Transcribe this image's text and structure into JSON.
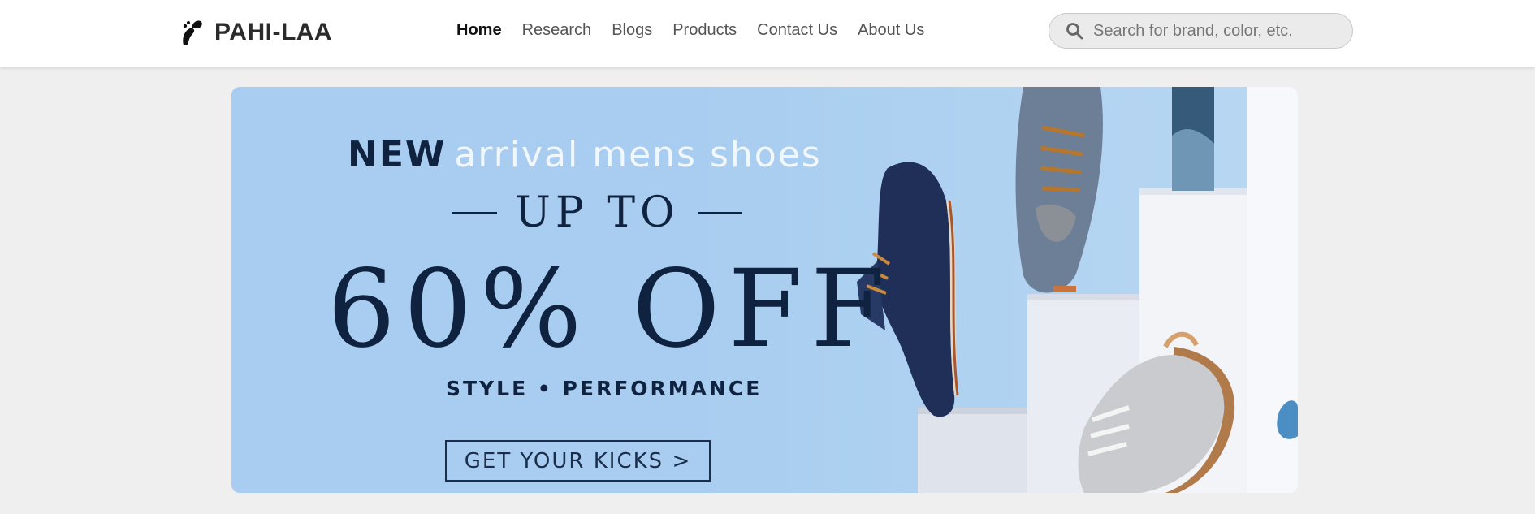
{
  "header": {
    "brand_name": "PAHI-LAA",
    "logo_icon": "footprint-logo-icon",
    "nav": [
      {
        "label": "Home",
        "active": true
      },
      {
        "label": "Research",
        "active": false
      },
      {
        "label": "Blogs",
        "active": false
      },
      {
        "label": "Products",
        "active": false
      },
      {
        "label": "Contact Us",
        "active": false
      },
      {
        "label": "About Us",
        "active": false
      }
    ],
    "search": {
      "icon": "search-icon",
      "placeholder": "Search for brand, color, etc.",
      "value": ""
    }
  },
  "banner": {
    "headline_new": "NEW",
    "headline_rest": "arrival mens shoes",
    "upto": "UP TO",
    "discount": "60% OFF",
    "tagline": "STYLE • PERFORMANCE",
    "cta_label": "GET YOUR KICKS  >",
    "image": "shoes-on-white-steps-image"
  },
  "colors": {
    "header_bg": "#ffffff",
    "page_bg": "#efefef",
    "banner_bg": "#a8cdf0",
    "banner_text": "#0f2340",
    "nav_active": "#111111",
    "nav_text": "#555555"
  }
}
